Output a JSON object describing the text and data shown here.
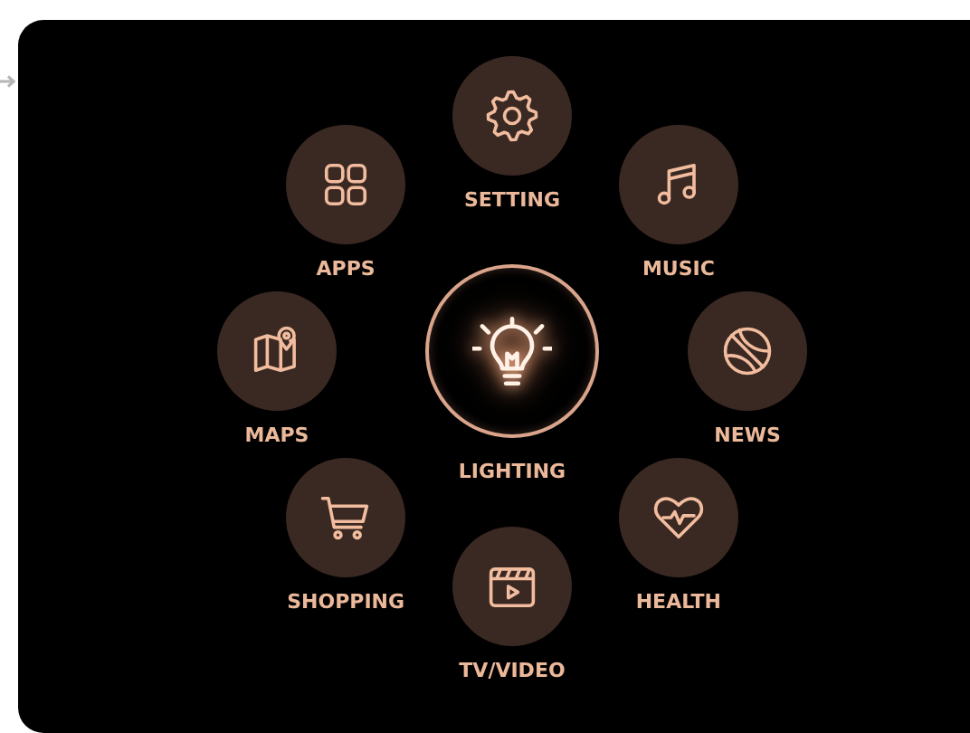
{
  "center_item": {
    "label": "LIGHTING",
    "kind": "bulb",
    "selected": true
  },
  "items": [
    {
      "label": "SETTING",
      "kind": "gear",
      "selected": false
    },
    {
      "label": "MUSIC",
      "kind": "music",
      "selected": false
    },
    {
      "label": "NEWS",
      "kind": "ball",
      "selected": false
    },
    {
      "label": "HEALTH",
      "kind": "heart",
      "selected": false
    },
    {
      "label": "TV/VIDEO",
      "kind": "clapper",
      "selected": false
    },
    {
      "label": "SHOPPING",
      "kind": "cart",
      "selected": false
    },
    {
      "label": "MAPS",
      "kind": "map",
      "selected": false
    },
    {
      "label": "APPS",
      "kind": "grid",
      "selected": false
    }
  ]
}
